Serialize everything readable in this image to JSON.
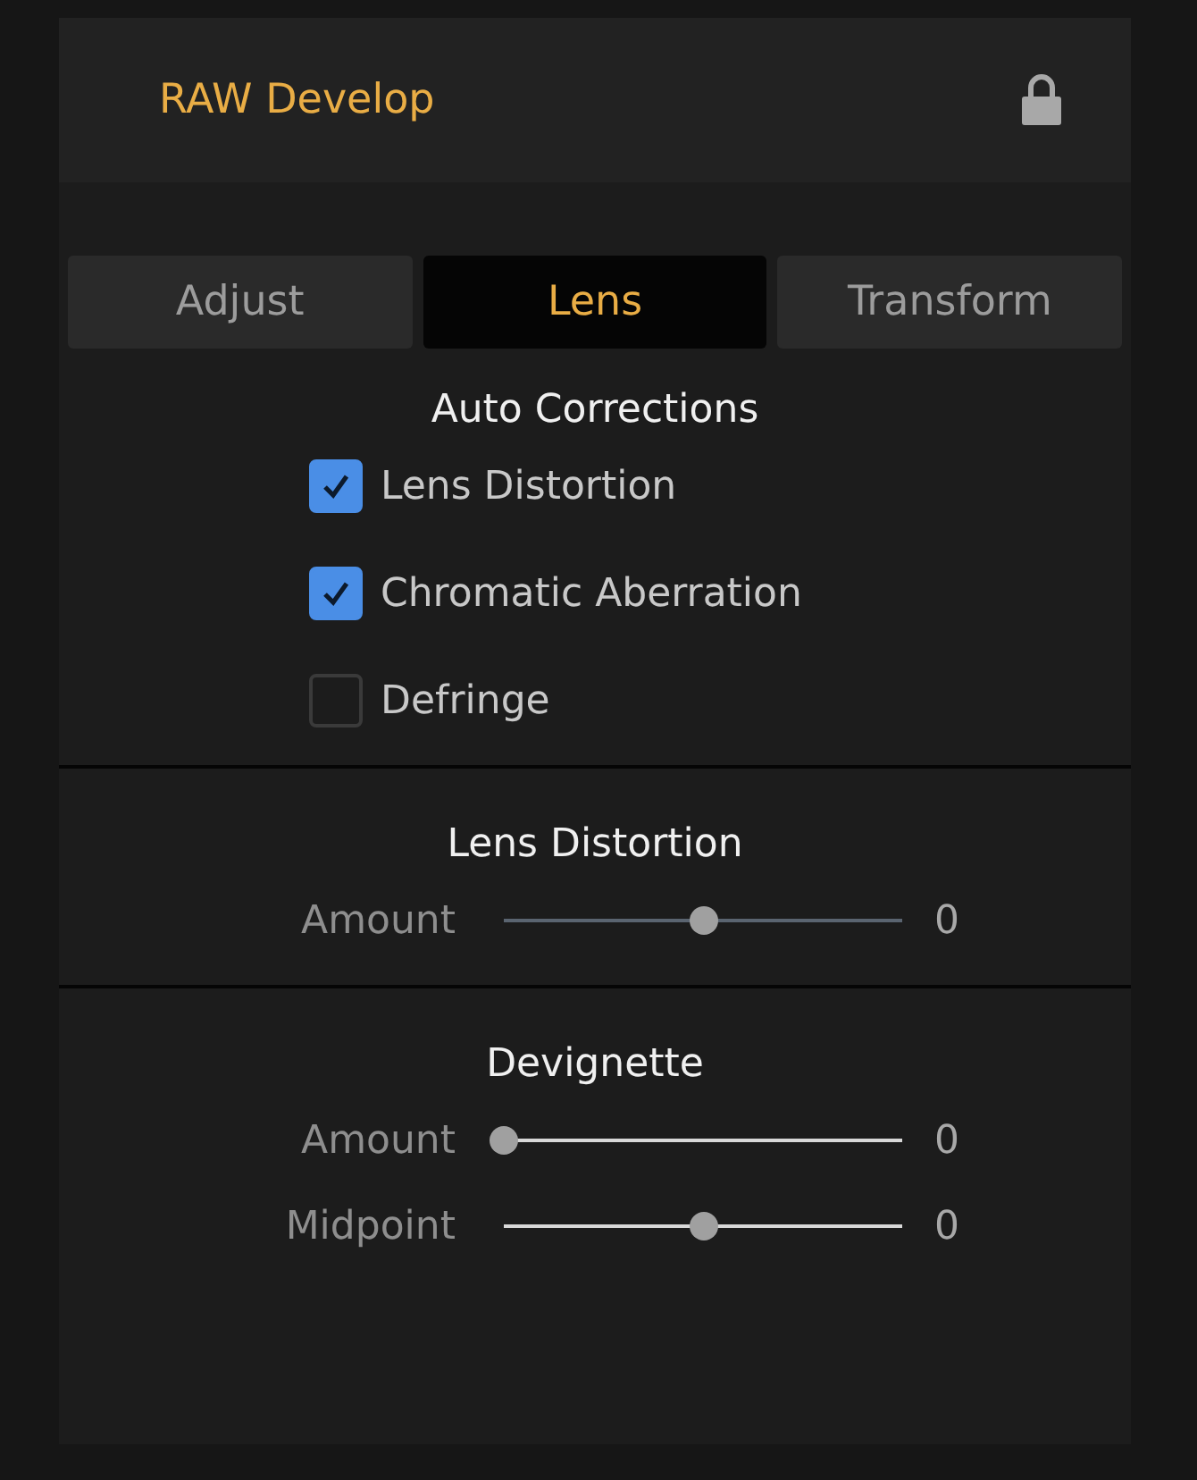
{
  "panel": {
    "title": "RAW Develop",
    "locked": true
  },
  "tabs": [
    {
      "label": "Adjust",
      "selected": false
    },
    {
      "label": "Lens",
      "selected": true
    },
    {
      "label": "Transform",
      "selected": false
    }
  ],
  "sections": [
    {
      "title": "Auto Corrections",
      "kind": "checks",
      "items": [
        {
          "label": "Lens Distortion",
          "checked": true
        },
        {
          "label": "Chromatic Aberration",
          "checked": true
        },
        {
          "label": "Defringe",
          "checked": false
        }
      ]
    },
    {
      "title": "Lens Distortion",
      "kind": "sliders",
      "items": [
        {
          "label": "Amount",
          "level": 0.5,
          "reading": "0",
          "disabled": true
        }
      ]
    },
    {
      "title": "Devignette",
      "kind": "sliders",
      "items": [
        {
          "label": "Amount",
          "level": 0,
          "reading": "0",
          "disabled": false
        },
        {
          "label": "Midpoint",
          "level": 0.5,
          "reading": "0",
          "disabled": false
        }
      ]
    }
  ]
}
